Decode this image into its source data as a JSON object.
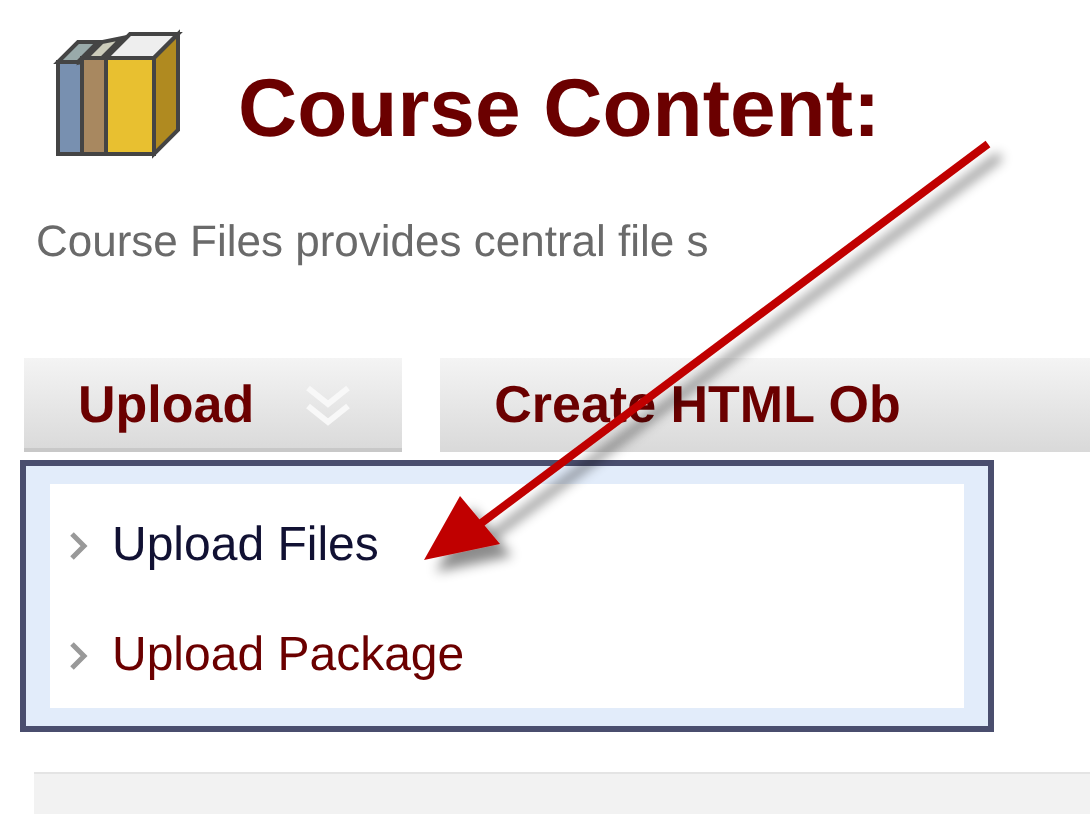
{
  "header": {
    "title": "Course Content:",
    "description": "Course Files provides central file s"
  },
  "toolbar": {
    "buttons": [
      {
        "label": "Upload",
        "kind": "menu",
        "expanded": true
      },
      {
        "label": "Create HTML Ob",
        "kind": "plain",
        "expanded": false
      }
    ]
  },
  "menu": {
    "items": [
      {
        "label": "Upload Files",
        "selected": true
      },
      {
        "label": "Upload Package",
        "selected": false
      }
    ]
  }
}
